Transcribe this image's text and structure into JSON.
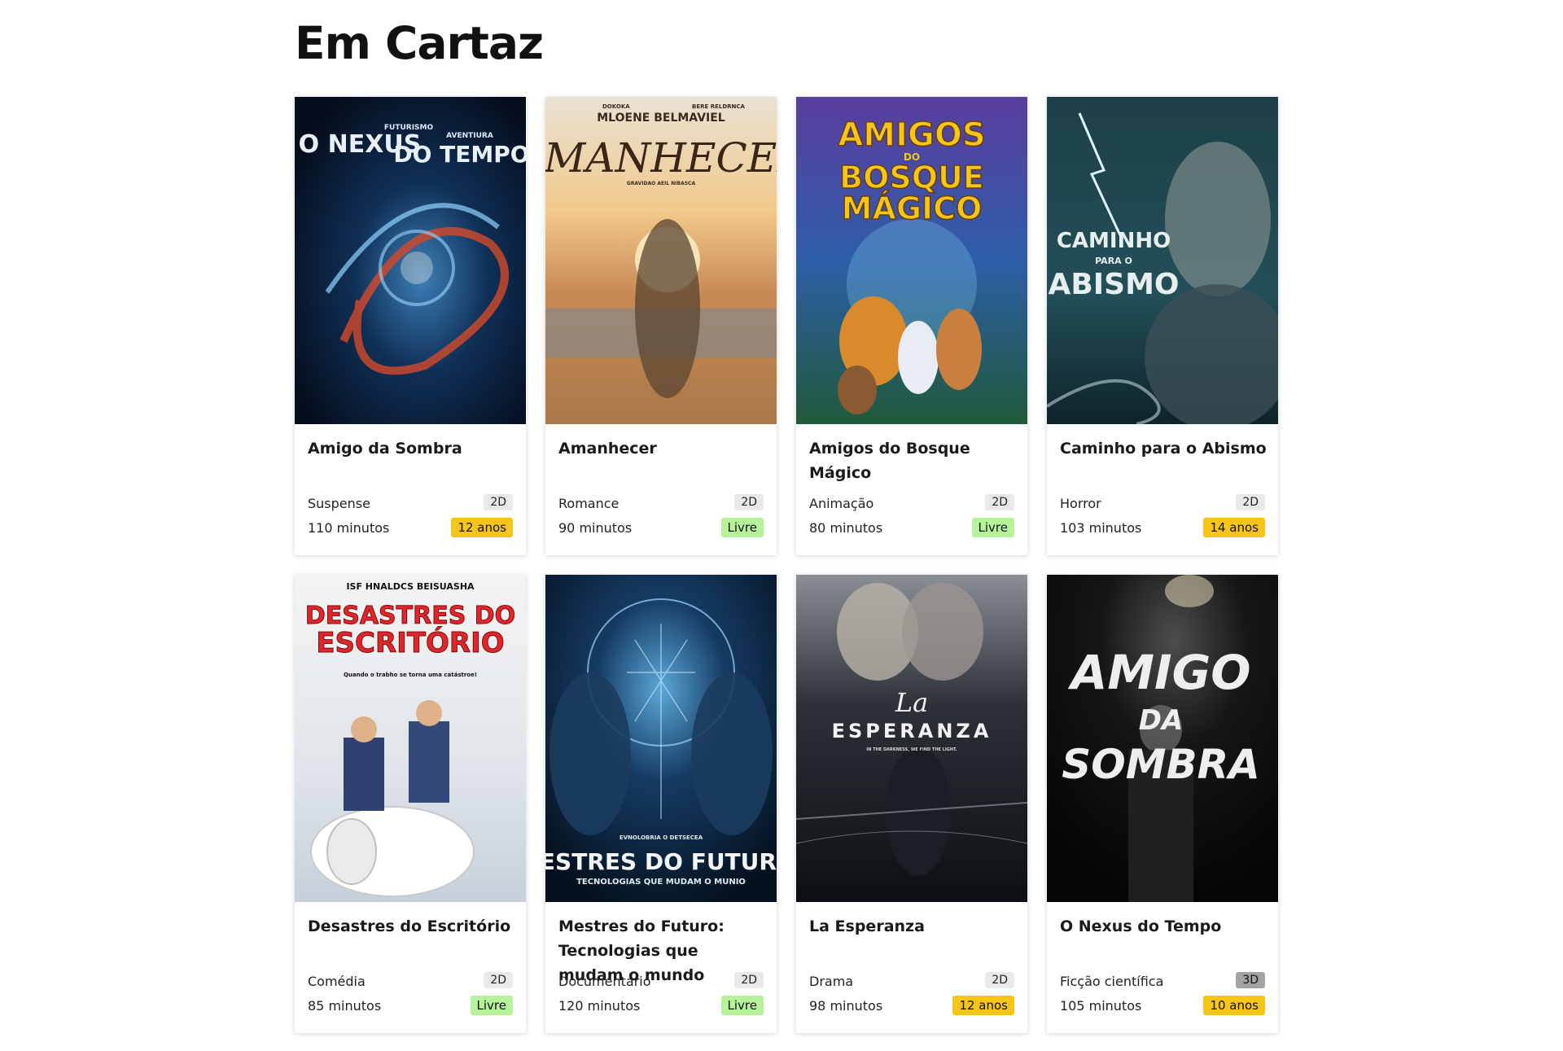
{
  "page": {
    "title": "Em Cartaz"
  },
  "colors": {
    "badge_12": "#f5c518",
    "badge_10": "#f5c518",
    "badge_14": "#f5c518",
    "badge_livre": "#b6f29a",
    "badge_2d": "#e9e9e9",
    "badge_3d": "#a3a3a3"
  },
  "movies": [
    {
      "title": "Amigo da Sombra",
      "genre": "Suspense",
      "duration": "110 minutos",
      "format": "2D",
      "rating": "12 anos",
      "rating_color": "#f5c518",
      "poster_text": [
        "FUTURISMO",
        "O NEXUS",
        "AVENTIURA",
        "DO TEMPO"
      ]
    },
    {
      "title": "Amanhecer",
      "genre": "Romance",
      "duration": "90 minutos",
      "format": "2D",
      "rating": "Livre",
      "rating_color": "#b6f29a",
      "poster_text": [
        "DOKOKA",
        "BERE RELDRNCA",
        "MLOENE BELMAVIEL",
        "AMANHECER",
        "GRAVIDAO AEIL NIBASCA"
      ]
    },
    {
      "title": "Amigos do Bosque Mágico",
      "genre": "Animação",
      "duration": "80 minutos",
      "format": "2D",
      "rating": "Livre",
      "rating_color": "#b6f29a",
      "poster_text": [
        "AMIGOS",
        "DO",
        "BOSQUE",
        "MÁGICO"
      ]
    },
    {
      "title": "Caminho para o Abismo",
      "genre": "Horror",
      "duration": "103 minutos",
      "format": "2D",
      "rating": "14 anos",
      "rating_color": "#f5c518",
      "poster_text": [
        "CAMINHO",
        "PARA O",
        "ABISMO"
      ]
    },
    {
      "title": "Desastres do Escritório",
      "genre": "Comédia",
      "duration": "85 minutos",
      "format": "2D",
      "rating": "Livre",
      "rating_color": "#b6f29a",
      "poster_text": [
        "ISF HNALDCS BEISUASHA",
        "DESASTRES DO",
        "ESCRITÓRIO",
        "Quando o trabho se torna uma catástroe!"
      ]
    },
    {
      "title": "Mestres do Futuro: Tecnologias que mudam o mundo",
      "genre": "Documentário",
      "duration": "120 minutos",
      "format": "2D",
      "rating": "Livre",
      "rating_color": "#b6f29a",
      "poster_text": [
        "EVNOLOBRIA O DETSECEA",
        "MESTRES DO FUTURO:",
        "TECNOLOGIAS QUE MUDAM O MUNIO"
      ]
    },
    {
      "title": "La Esperanza",
      "genre": "Drama",
      "duration": "98 minutos",
      "format": "2D",
      "rating": "12 anos",
      "rating_color": "#f5c518",
      "poster_text": [
        "La",
        "ESPERANZA",
        "IN THE DARKNESS, WE FIND THE LIGHT."
      ]
    },
    {
      "title": "O Nexus do Tempo",
      "genre": "Ficção científica",
      "duration": "105 minutos",
      "format": "3D",
      "rating": "10 anos",
      "rating_color": "#f5c518",
      "poster_text": [
        "AMIGO",
        "DA",
        "SOMBRA"
      ]
    }
  ]
}
